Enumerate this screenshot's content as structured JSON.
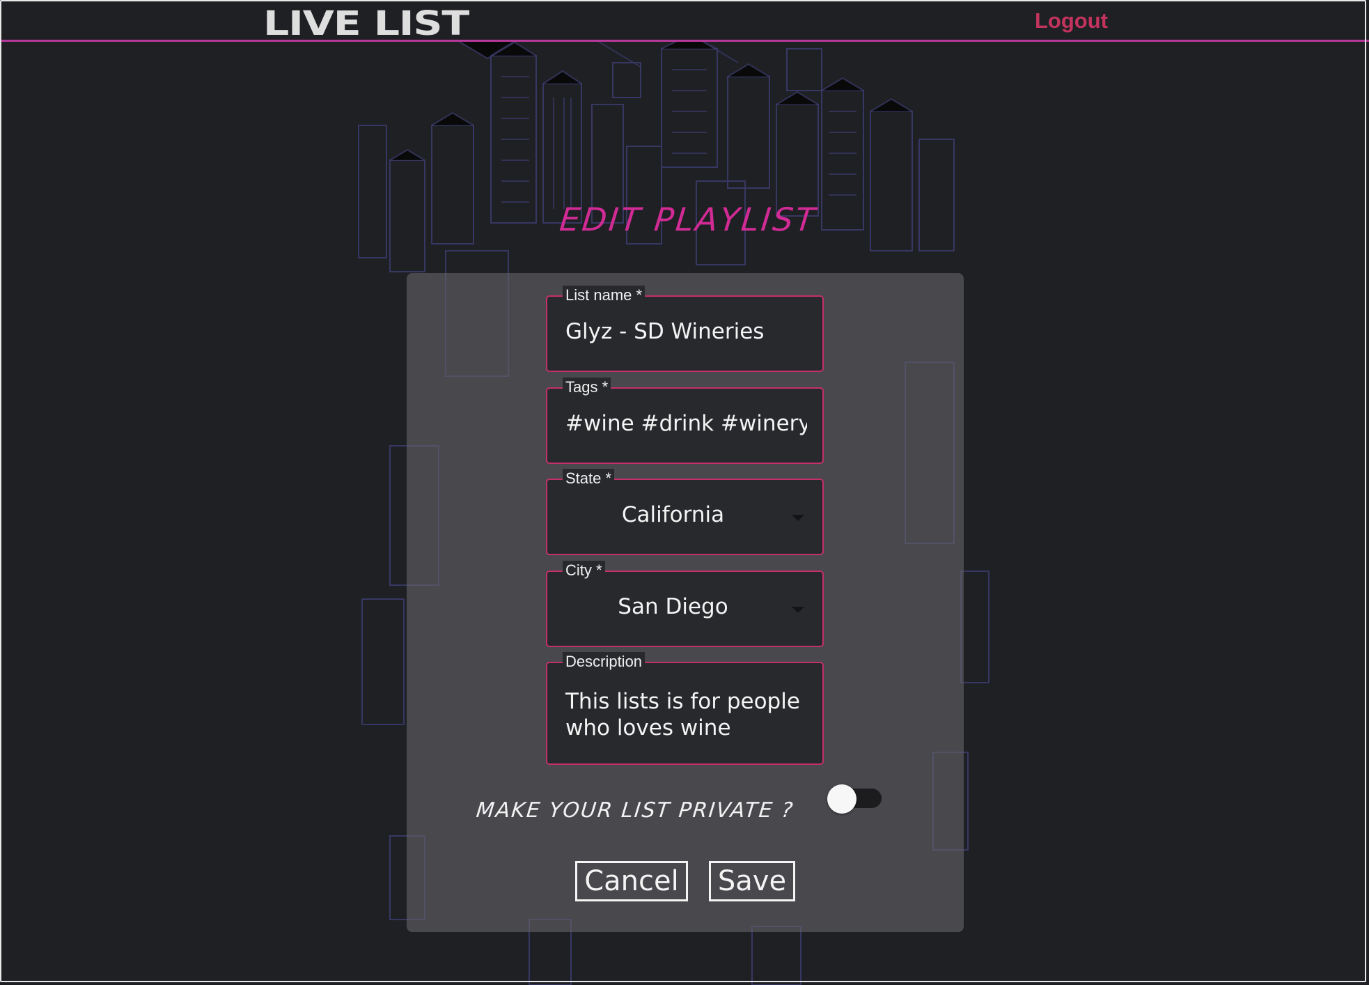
{
  "header": {
    "logo": "LIVE LIST",
    "logout_label": "Logout"
  },
  "page": {
    "title": "EDIT PLAYLIST"
  },
  "form": {
    "list_name": {
      "label": "List name *",
      "value": "Glyz - SD Wineries"
    },
    "tags": {
      "label": "Tags *",
      "value": "#wine #drink #winery #alcohol"
    },
    "state": {
      "label": "State *",
      "value": "California"
    },
    "city": {
      "label": "City *",
      "value": "San Diego"
    },
    "description": {
      "label": "Description",
      "value": "This lists is for people who loves wine"
    },
    "private": {
      "label": "MAKE YOUR LIST PRIVATE ?",
      "on": false
    },
    "cancel_label": "Cancel",
    "save_label": "Save"
  },
  "colors": {
    "accent": "#c4306a",
    "title": "#d12b95",
    "background": "#1f2024",
    "header_line": "#b5399a"
  }
}
